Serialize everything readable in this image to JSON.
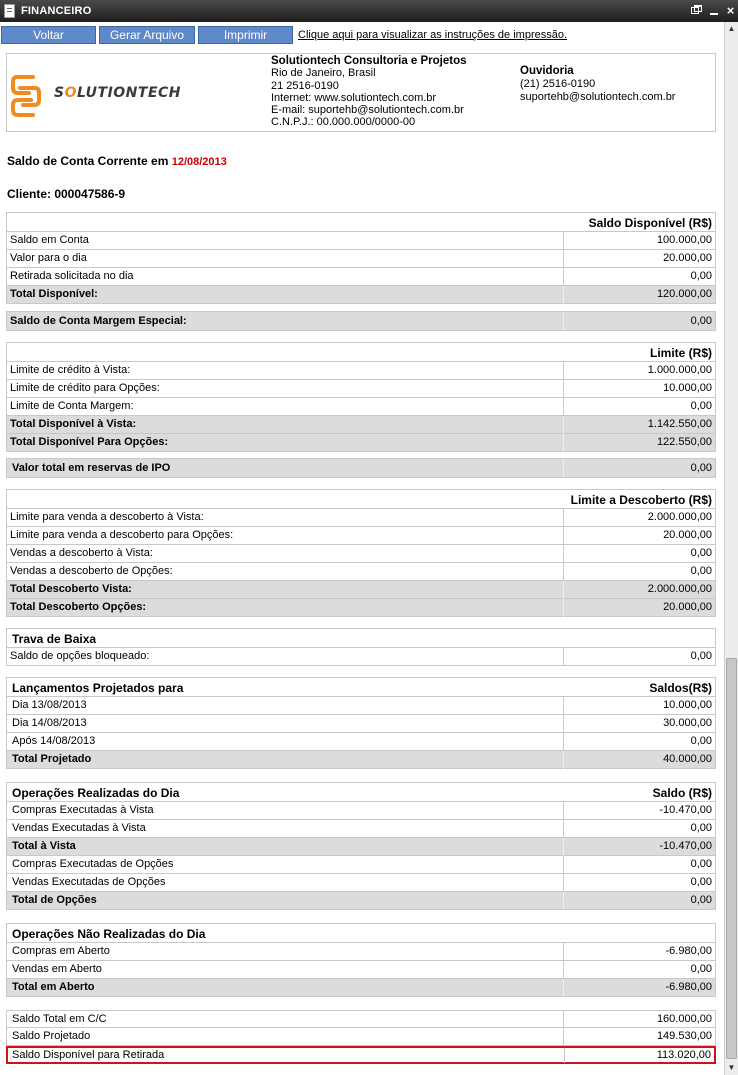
{
  "window": {
    "title": "FINANCEIRO",
    "restore_icon": "restore-window-icon",
    "minimize_icon": "minimize-icon",
    "close_glyph": "×"
  },
  "toolbar": {
    "back_label": "Voltar",
    "export_label": "Gerar Arquivo",
    "print_label": "Imprimir",
    "instructions_link": "Clique aqui para visualizar as instruções de impressão."
  },
  "company": {
    "logo_text_pre": "S",
    "logo_text_o": "O",
    "logo_text_post": "LUTIONTECH",
    "name": "Solutiontech Consultoria e Projetos",
    "city": "Rio de Janeiro, Brasil",
    "phone": "21 2516-0190",
    "internet": "Internet:  www.solutiontech.com.br",
    "email": "E-mail:  suportehb@solutiontech.com.br",
    "cnpj": "C.N.P.J.: 00.000.000/0000-00",
    "ombudsman_title": "Ouvidoria",
    "ombudsman_phone": "(21) 2516-0190",
    "ombudsman_email": "suportehb@solutiontech.com.br"
  },
  "statement": {
    "heading": "Saldo de Conta Corrente em",
    "date": "12/08/2013",
    "client": "Cliente: 000047586-9"
  },
  "available": {
    "header": "Saldo Disponível (R$)",
    "rows": [
      {
        "label": "Saldo em Conta",
        "value": "100.000,00"
      },
      {
        "label": "Valor para o dia",
        "value": "20.000,00"
      },
      {
        "label": "Retirada solicitada no dia",
        "value": "0,00"
      }
    ],
    "total_label": "Total Disponível:",
    "total_value": "120.000,00",
    "margin_label": "Saldo de Conta Margem Especial:",
    "margin_value": "0,00"
  },
  "limit": {
    "header": "Limite (R$)",
    "rows": [
      {
        "label": "Limite de crédito à Vista:",
        "value": "1.000.000,00"
      },
      {
        "label": "Limite de crédito para Opções:",
        "value": "10.000,00"
      },
      {
        "label": "Limite de Conta Margem:",
        "value": "0,00"
      }
    ],
    "total_spot_label": "Total Disponível à Vista:",
    "total_spot_value": "1.142.550,00",
    "total_options_label": "Total Disponível Para Opções:",
    "total_options_value": "122.550,00",
    "ipo_label": "Valor total em reservas de IPO",
    "ipo_value": "0,00"
  },
  "short": {
    "header": "Limite a Descoberto (R$)",
    "rows": [
      {
        "label": "Limite para venda a descoberto à Vista:",
        "value": "2.000.000,00"
      },
      {
        "label": "Limite para venda a descoberto para Opções:",
        "value": "20.000,00"
      },
      {
        "label": "Vendas a descoberto à Vista:",
        "value": "0,00"
      },
      {
        "label": "Vendas a descoberto de Opções:",
        "value": "0,00"
      }
    ],
    "total_spot_label": "Total Descoberto Vista:",
    "total_spot_value": "2.000.000,00",
    "total_options_label": "Total Descoberto Opções:",
    "total_options_value": "20.000,00"
  },
  "lock": {
    "header": "Trava de Baixa",
    "row_label": "Saldo de opções bloqueado:",
    "row_value": "0,00"
  },
  "projected": {
    "header_left": "Lançamentos Projetados para",
    "header_right": "Saldos(R$)",
    "rows": [
      {
        "label": "Dia 13/08/2013",
        "value": "10.000,00"
      },
      {
        "label": "Dia 14/08/2013",
        "value": "30.000,00"
      },
      {
        "label": "Após 14/08/2013",
        "value": "0,00"
      }
    ],
    "total_label": "Total Projetado",
    "total_value": "40.000,00"
  },
  "operations": {
    "header_left": "Operações Realizadas do Dia",
    "header_right": "Saldo (R$)",
    "rows_spot": [
      {
        "label": "Compras Executadas à Vista",
        "value": "-10.470,00"
      },
      {
        "label": "Vendas Executadas à Vista",
        "value": "0,00"
      }
    ],
    "total_spot_label": "Total à Vista",
    "total_spot_value": "-10.470,00",
    "rows_options": [
      {
        "label": "Compras Executadas de Opções",
        "value": "0,00"
      },
      {
        "label": "Vendas Executadas de Opções",
        "value": "0,00"
      }
    ],
    "total_options_label": "Total de Opções",
    "total_options_value": "0,00"
  },
  "open_operations": {
    "header": "Operações Não Realizadas do Dia",
    "rows": [
      {
        "label": "Compras em Aberto",
        "value": "-6.980,00"
      },
      {
        "label": "Vendas em Aberto",
        "value": "0,00"
      }
    ],
    "total_label": "Total em Aberto",
    "total_value": "-6.980,00"
  },
  "summary": {
    "rows": [
      {
        "label": "Saldo Total em C/C",
        "value": "160.000,00"
      },
      {
        "label": "Saldo Projetado",
        "value": "149.530,00"
      }
    ],
    "withdrawal_label": "Saldo Disponível para Retirada",
    "withdrawal_value": "113.020,00",
    "highlight_color": "#d0121b"
  },
  "scrollbar": {
    "up_arrow": "▲",
    "down_arrow": "▼"
  }
}
